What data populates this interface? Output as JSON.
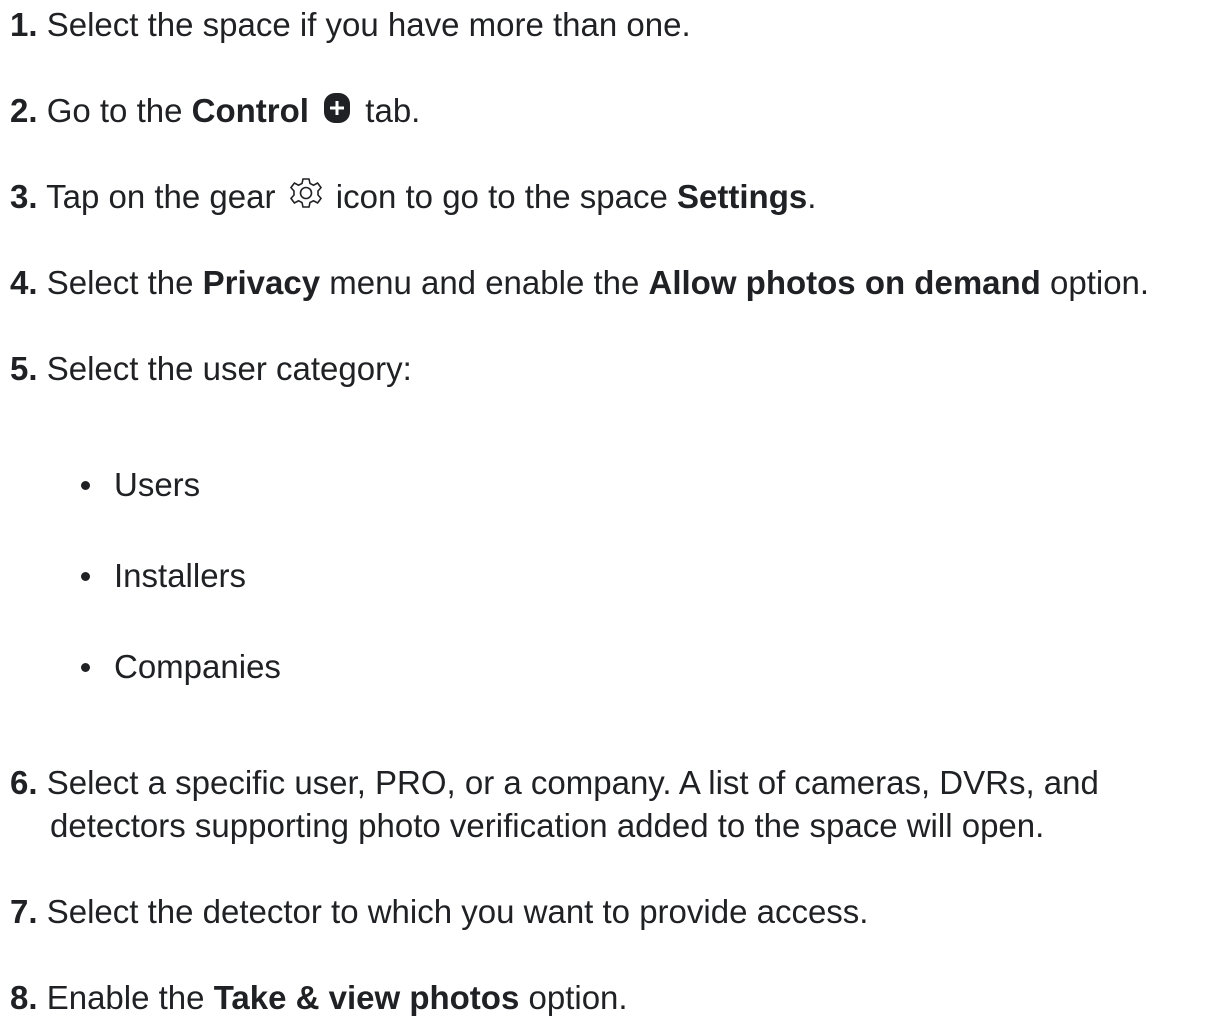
{
  "steps": [
    {
      "num": "1.",
      "text": "Select the space if you have more than one."
    },
    {
      "num": "2.",
      "pre": "Go to the",
      "bold": "Control",
      "post": "tab.",
      "icon": "control-plus-icon"
    },
    {
      "num": "3.",
      "pre": "Tap on the gear",
      "mid": "icon to go to the space",
      "bold": "Settings",
      "post": ".",
      "icon": "gear-icon"
    },
    {
      "num": "4.",
      "pre": "Select the",
      "bold1": "Privacy",
      "mid": "menu and enable the",
      "bold2": "Allow photos on demand",
      "post": "option."
    },
    {
      "num": "5.",
      "text": "Select the user category:"
    },
    {
      "num": "6.",
      "line1": "Select a specific user, PRO, or a company. A list of cameras, DVRs, and",
      "line2": "detectors supporting photo verification added to the space will open."
    },
    {
      "num": "7.",
      "text": "Select the detector to which you want to provide access."
    },
    {
      "num": "8.",
      "pre": "Enable the",
      "bold": "Take & view photos",
      "post": "option."
    }
  ],
  "user_categories": [
    "Users",
    "Installers",
    "Companies"
  ],
  "colors": {
    "text": "#202124",
    "background": "#ffffff"
  }
}
